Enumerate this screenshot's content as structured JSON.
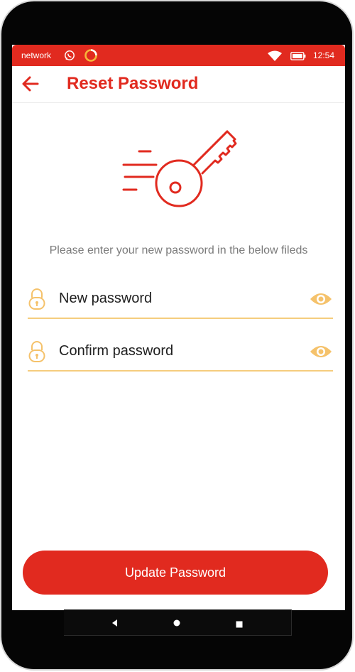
{
  "status_bar": {
    "carrier": "network",
    "time": "12:54",
    "icons": [
      "whatsapp-icon",
      "ring-app-icon",
      "wifi-icon",
      "battery-icon"
    ]
  },
  "app_bar": {
    "back_icon": "arrow-left-icon",
    "title": "Reset Password"
  },
  "illustration": "key-icon",
  "instructions": "Please enter your new password in the below fileds",
  "fields": {
    "new_password": {
      "placeholder": "New password",
      "value": "",
      "icon": "lock-icon",
      "toggle_icon": "eye-icon"
    },
    "confirm_password": {
      "placeholder": "Confirm password",
      "value": "",
      "icon": "lock-icon",
      "toggle_icon": "eye-icon"
    }
  },
  "submit_button": {
    "label": "Update Password"
  },
  "nav_bar": {
    "icons": [
      "back-triangle-icon",
      "home-circle-icon",
      "recents-square-icon"
    ]
  },
  "colors": {
    "primary": "#e12a1f",
    "accent": "#f5c26b",
    "text_muted": "#7a7a7a"
  }
}
